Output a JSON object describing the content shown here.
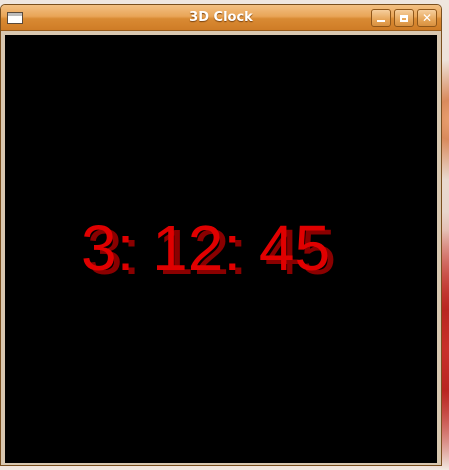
{
  "window": {
    "title": "3D Clock",
    "icons": {
      "app": "window-app-icon",
      "minimize": "minimize-icon",
      "maximize": "maximize-icon",
      "close": "close-icon"
    }
  },
  "clock": {
    "time_text": "3: 12: 45",
    "color": "#e00000",
    "shadow_color": "#8a0000",
    "background": "#000000"
  }
}
